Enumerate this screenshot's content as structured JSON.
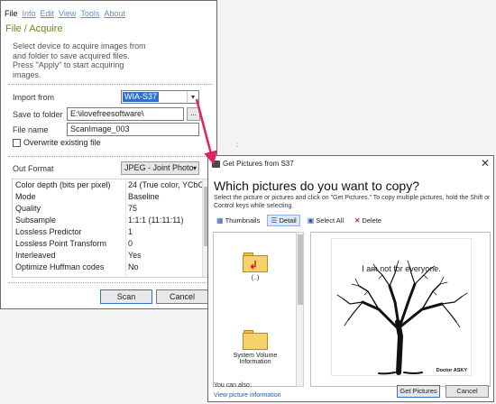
{
  "acquire_window": {
    "menu": [
      "File",
      "Info",
      "Edit",
      "View",
      "Tools",
      "About"
    ],
    "title": "File / Acquire",
    "description": "Select device to acquire images from and folder to save acquired files. Press \"Apply\" to start acquiring images.",
    "import_from_label": "Import from",
    "import_from_value": "WIA-S37",
    "save_to_folder_label": "Save to folder",
    "save_to_folder_value": "E:\\ilovefreesoftware\\",
    "browse_label": "...",
    "file_name_label": "File name",
    "file_name_value": "ScanImage_003",
    "overwrite_label": "Overwrite existing file",
    "out_format_label": "Out Format",
    "out_format_value": "JPEG - Joint Photo",
    "properties": [
      {
        "key": "Color depth (bits per pixel)",
        "value": "24 (True color, YCbC"
      },
      {
        "key": "Mode",
        "value": "Baseline"
      },
      {
        "key": "Quality",
        "value": "75"
      },
      {
        "key": "Subsample",
        "value": "1:1:1 (11:11:11)"
      },
      {
        "key": "Lossless Predictor",
        "value": "1"
      },
      {
        "key": "Lossless Point Transform",
        "value": "0"
      },
      {
        "key": "Interleaved",
        "value": "Yes"
      },
      {
        "key": "Optimize Huffman codes",
        "value": "No"
      }
    ],
    "scan_label": "Scan",
    "cancel_label": "Cancel"
  },
  "stray_text": ":",
  "get_pictures_dialog": {
    "title": "Get Pictures from S37",
    "heading": "Which pictures do you want to copy?",
    "instructions": "Select the picture or pictures and click on \"Get Pictures.\"  To copy multiple pictures, hold the Shift or Control keys while selecting.",
    "toolbar": {
      "thumbnails": "Thumbnails",
      "detail": "Detail",
      "select_all": "Select All",
      "delete": "Delete"
    },
    "files": [
      {
        "name": "(..)",
        "icon": "folder-up-icon"
      },
      {
        "name": "System Volume Information",
        "icon": "folder-icon"
      }
    ],
    "preview_caption": "I am not for everyone.",
    "preview_watermark": "Doctor ASKY",
    "you_can_also": "You can also:",
    "view_picture_information": "View picture information",
    "get_pictures_label": "Get Pictures",
    "cancel_label": "Cancel"
  },
  "colors": {
    "accent_green": "#6c8a1e",
    "link_blue": "#5b8fc9",
    "selection_blue": "#2f6fd0",
    "arrow_pink": "#e0245e"
  }
}
